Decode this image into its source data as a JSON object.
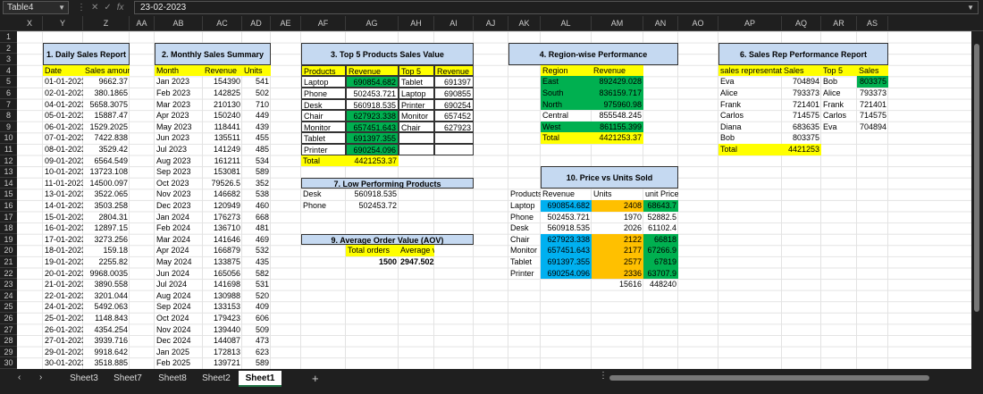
{
  "formula": {
    "name_box": "Table4",
    "value": "23-02-2023"
  },
  "columns": [
    "X",
    "Y",
    "Z",
    "AA",
    "AB",
    "AC",
    "AD",
    "AE",
    "AF",
    "AG",
    "AH",
    "AI",
    "AJ",
    "AK",
    "AL",
    "AM",
    "AN",
    "AO",
    "AP",
    "AQ",
    "AR",
    "AS"
  ],
  "rows": [
    "1",
    "2",
    "3",
    "4",
    "5",
    "6",
    "7",
    "8",
    "9",
    "10",
    "11",
    "12",
    "13",
    "14",
    "15",
    "16",
    "17",
    "18",
    "19",
    "20",
    "21",
    "22",
    "23",
    "24",
    "25",
    "26",
    "27",
    "28",
    "29",
    "30"
  ],
  "daily": {
    "title": "1. Daily Sales Report",
    "h": [
      "Date",
      "Sales amount"
    ],
    "rows": [
      [
        "01-01-2023",
        "9662.37"
      ],
      [
        "02-01-2023",
        "380.1865"
      ],
      [
        "04-01-2023",
        "5658.3075"
      ],
      [
        "05-01-2023",
        "15887.47"
      ],
      [
        "06-01-2023",
        "1529.2025"
      ],
      [
        "07-01-2023",
        "7422.838"
      ],
      [
        "08-01-2023",
        "3529.42"
      ],
      [
        "09-01-2023",
        "6564.549"
      ],
      [
        "10-01-2023",
        "13723.108"
      ],
      [
        "11-01-2023",
        "14500.097"
      ],
      [
        "13-01-2023",
        "3522.065"
      ],
      [
        "14-01-2023",
        "3503.258"
      ],
      [
        "15-01-2023",
        "2804.31"
      ],
      [
        "16-01-2023",
        "12897.15"
      ],
      [
        "17-01-2023",
        "3273.256"
      ],
      [
        "18-01-2023",
        "159.18"
      ],
      [
        "19-01-2023",
        "2255.82"
      ],
      [
        "20-01-2023",
        "9968.0035"
      ],
      [
        "21-01-2023",
        "3890.558"
      ],
      [
        "22-01-2023",
        "3201.044"
      ],
      [
        "24-01-2023",
        "5492.063"
      ],
      [
        "25-01-2023",
        "1148.843"
      ],
      [
        "26-01-2023",
        "4354.254"
      ],
      [
        "27-01-2023",
        "3939.716"
      ],
      [
        "29-01-2023",
        "9918.642"
      ],
      [
        "30-01-2023",
        "3518.885"
      ],
      [
        "31-01-2023",
        "1685.0495"
      ]
    ]
  },
  "monthly": {
    "title": "2. Monthly Sales Summary",
    "h": [
      "Month",
      "Revenue",
      "Units"
    ],
    "rows": [
      [
        "Jan 2023",
        "154390",
        "541"
      ],
      [
        "Feb 2023",
        "142825",
        "502"
      ],
      [
        "Mar 2023",
        "210130",
        "710"
      ],
      [
        "Apr 2023",
        "150240",
        "449"
      ],
      [
        "May 2023",
        "118441",
        "439"
      ],
      [
        "Jun 2023",
        "135511",
        "455"
      ],
      [
        "Jul 2023",
        "141249",
        "485"
      ],
      [
        "Aug 2023",
        "161211",
        "534"
      ],
      [
        "Sep 2023",
        "153081",
        "589"
      ],
      [
        "Oct 2023",
        "79526.5",
        "352"
      ],
      [
        "Nov 2023",
        "146682",
        "538"
      ],
      [
        "Dec 2023",
        "120949",
        "460"
      ],
      [
        "Jan 2024",
        "176273",
        "668"
      ],
      [
        "Feb 2024",
        "136710",
        "481"
      ],
      [
        "Mar 2024",
        "141646",
        "469"
      ],
      [
        "Apr 2024",
        "166879",
        "532"
      ],
      [
        "May 2024",
        "133875",
        "435"
      ],
      [
        "Jun 2024",
        "165056",
        "582"
      ],
      [
        "Jul 2024",
        "141698",
        "531"
      ],
      [
        "Aug 2024",
        "130988",
        "520"
      ],
      [
        "Sep 2024",
        "133153",
        "409"
      ],
      [
        "Oct 2024",
        "179423",
        "606"
      ],
      [
        "Nov 2024",
        "139440",
        "509"
      ],
      [
        "Dec 2024",
        "144087",
        "473"
      ],
      [
        "Jan 2025",
        "172813",
        "623"
      ],
      [
        "Feb 2025",
        "139721",
        "589"
      ],
      [
        "Mar 2025",
        "184946",
        "632"
      ]
    ]
  },
  "top5": {
    "title": "3. Top 5 Products Sales Value",
    "h": [
      "Products",
      "Revenue",
      "Top 5",
      "Revenue"
    ],
    "rows": [
      [
        "Laptop",
        "690854.682",
        "Tablet",
        "691397"
      ],
      [
        "Phone",
        "502453.721",
        "Laptop",
        "690855"
      ],
      [
        "Desk",
        "560918.535",
        "Printer",
        "690254"
      ],
      [
        "Chair",
        "627923.338",
        "Monitor",
        "657452"
      ],
      [
        "Monitor",
        "657451.643",
        "Chair",
        "627923"
      ],
      [
        "Tablet",
        "691397.355",
        "",
        ""
      ],
      [
        "Printer",
        "690254.096",
        "",
        ""
      ]
    ],
    "total_label": "Total",
    "total": "4421253.37"
  },
  "region": {
    "title": "4. Region-wise Performance",
    "h": [
      "Region",
      "Revenue"
    ],
    "rows": [
      [
        "East",
        "892429.028"
      ],
      [
        "South",
        "836159.717"
      ],
      [
        "North",
        "975960.98"
      ],
      [
        "Central",
        "855548.245"
      ],
      [
        "West",
        "861155.399"
      ]
    ],
    "total_label": "Total",
    "total": "4421253.37"
  },
  "rep": {
    "title": "6. Sales Rep Performance Report",
    "h": [
      "sales representative",
      "Sales",
      "Top 5",
      "Sales"
    ],
    "rows": [
      [
        "Eva",
        "704894",
        "Bob",
        "803375"
      ],
      [
        "Alice",
        "793373",
        "Alice",
        "793373"
      ],
      [
        "Frank",
        "721401",
        "Frank",
        "721401"
      ],
      [
        "Carlos",
        "714575",
        "Carlos",
        "714575"
      ],
      [
        "Diana",
        "683635",
        "Eva",
        "704894"
      ],
      [
        "Bob",
        "803375",
        "",
        ""
      ]
    ],
    "total_label": "Total",
    "total": "4421253"
  },
  "low": {
    "title": "7. Low Performing Products",
    "rows": [
      [
        "Desk",
        "560918.535"
      ],
      [
        "Phone",
        "502453.72"
      ]
    ]
  },
  "aov": {
    "title": "9. Average Order Value (AOV)",
    "h": [
      "Total orders",
      "Average value"
    ],
    "row": [
      "1500",
      "2947.50225"
    ]
  },
  "price": {
    "title": "10. Price vs Units Sold",
    "h": [
      "Products",
      "Revenue",
      "Units",
      "unit Price"
    ],
    "rows": [
      [
        "Laptop",
        "690854.682",
        "2408",
        "68643.7"
      ],
      [
        "Phone",
        "502453.721",
        "1970",
        "52882.5"
      ],
      [
        "Desk",
        "560918.535",
        "2026",
        "61102.4"
      ],
      [
        "Chair",
        "627923.338",
        "2122",
        "66818"
      ],
      [
        "Monitor",
        "657451.643",
        "2177",
        "67266.9"
      ],
      [
        "Tablet",
        "691397.355",
        "2577",
        "67819"
      ],
      [
        "Printer",
        "690254.096",
        "2336",
        "63707.9"
      ]
    ],
    "totals": [
      "15616",
      "448240"
    ]
  },
  "sheets": [
    "Sheet3",
    "Sheet7",
    "Sheet8",
    "Sheet2",
    "Sheet1"
  ],
  "active_sheet": "Sheet1",
  "colors": {
    "green": "#00b050",
    "blue": "#00b0f0",
    "yellow": "#ffff00",
    "orange": "#ffc000",
    "title": "#c5d9f1"
  }
}
